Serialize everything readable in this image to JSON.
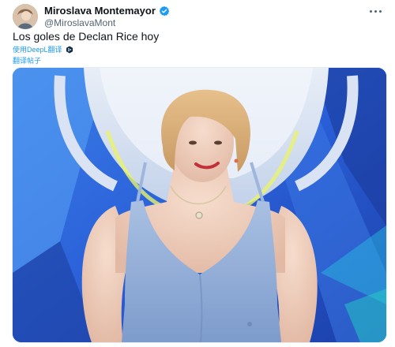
{
  "author": {
    "display_name": "Miroslava Montemayor",
    "handle": "@MiroslavaMont"
  },
  "tweet": {
    "text": "Los goles de Declan Rice hoy",
    "translate_with": "使用DeepL翻译",
    "translate_post": "翻译帖子"
  },
  "icons": {
    "verified": "verified-badge-icon",
    "more": "more-options-icon",
    "deepl": "deepl-icon"
  },
  "colors": {
    "accent": "#1d9bf0",
    "text": "#0f1419",
    "secondary": "#536471"
  }
}
